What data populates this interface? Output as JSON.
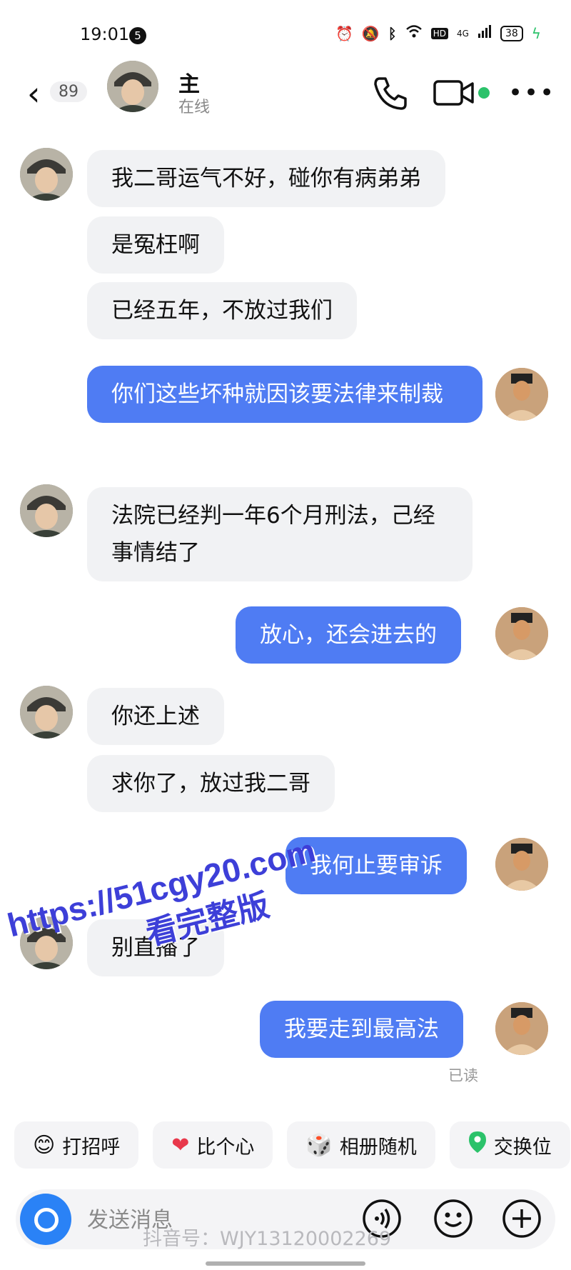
{
  "status_bar": {
    "time": "19:01",
    "notification_count": "5",
    "network": "4G",
    "hd": "HD",
    "battery": "38"
  },
  "header": {
    "back_count": "89",
    "name": "主",
    "status": "在线"
  },
  "messages": [
    {
      "side": "in",
      "text": "我二哥运气不好，碰你有病弟弟"
    },
    {
      "side": "in",
      "text": "是冤枉啊"
    },
    {
      "side": "in",
      "text": "已经五年，不放过我们"
    },
    {
      "side": "out",
      "text": "你们这些坏种就因该要法律来制裁"
    },
    {
      "side": "in",
      "text": "法院已经判一年6个月刑法，己经事情结了"
    },
    {
      "side": "out",
      "text": "放心，还会进去的"
    },
    {
      "side": "in",
      "text": "你还上述"
    },
    {
      "side": "in",
      "text": "求你了，放过我二哥"
    },
    {
      "side": "out",
      "text": "我何止要审诉"
    },
    {
      "side": "in",
      "text": "别直播了"
    },
    {
      "side": "out",
      "text": "我要走到最高法"
    }
  ],
  "read_receipt": "已读",
  "watermark": {
    "url": "https://51cgy20.com",
    "subtitle": "看完整版"
  },
  "quick_replies": [
    {
      "icon": "wave-emoji-icon",
      "label": "打招呼"
    },
    {
      "icon": "heart-icon",
      "label": "比个心"
    },
    {
      "icon": "dice-icon",
      "label": "相册随机"
    },
    {
      "icon": "location-pin-icon",
      "label": "交换位"
    }
  ],
  "input": {
    "placeholder": "发送消息"
  },
  "tiktok_id": "抖音号：WJY13120002269",
  "colors": {
    "outgoing_bubble": "#4f7cf3",
    "incoming_bubble": "#f1f2f4",
    "online": "#2bc26a",
    "camera_button": "#2a82f6"
  }
}
